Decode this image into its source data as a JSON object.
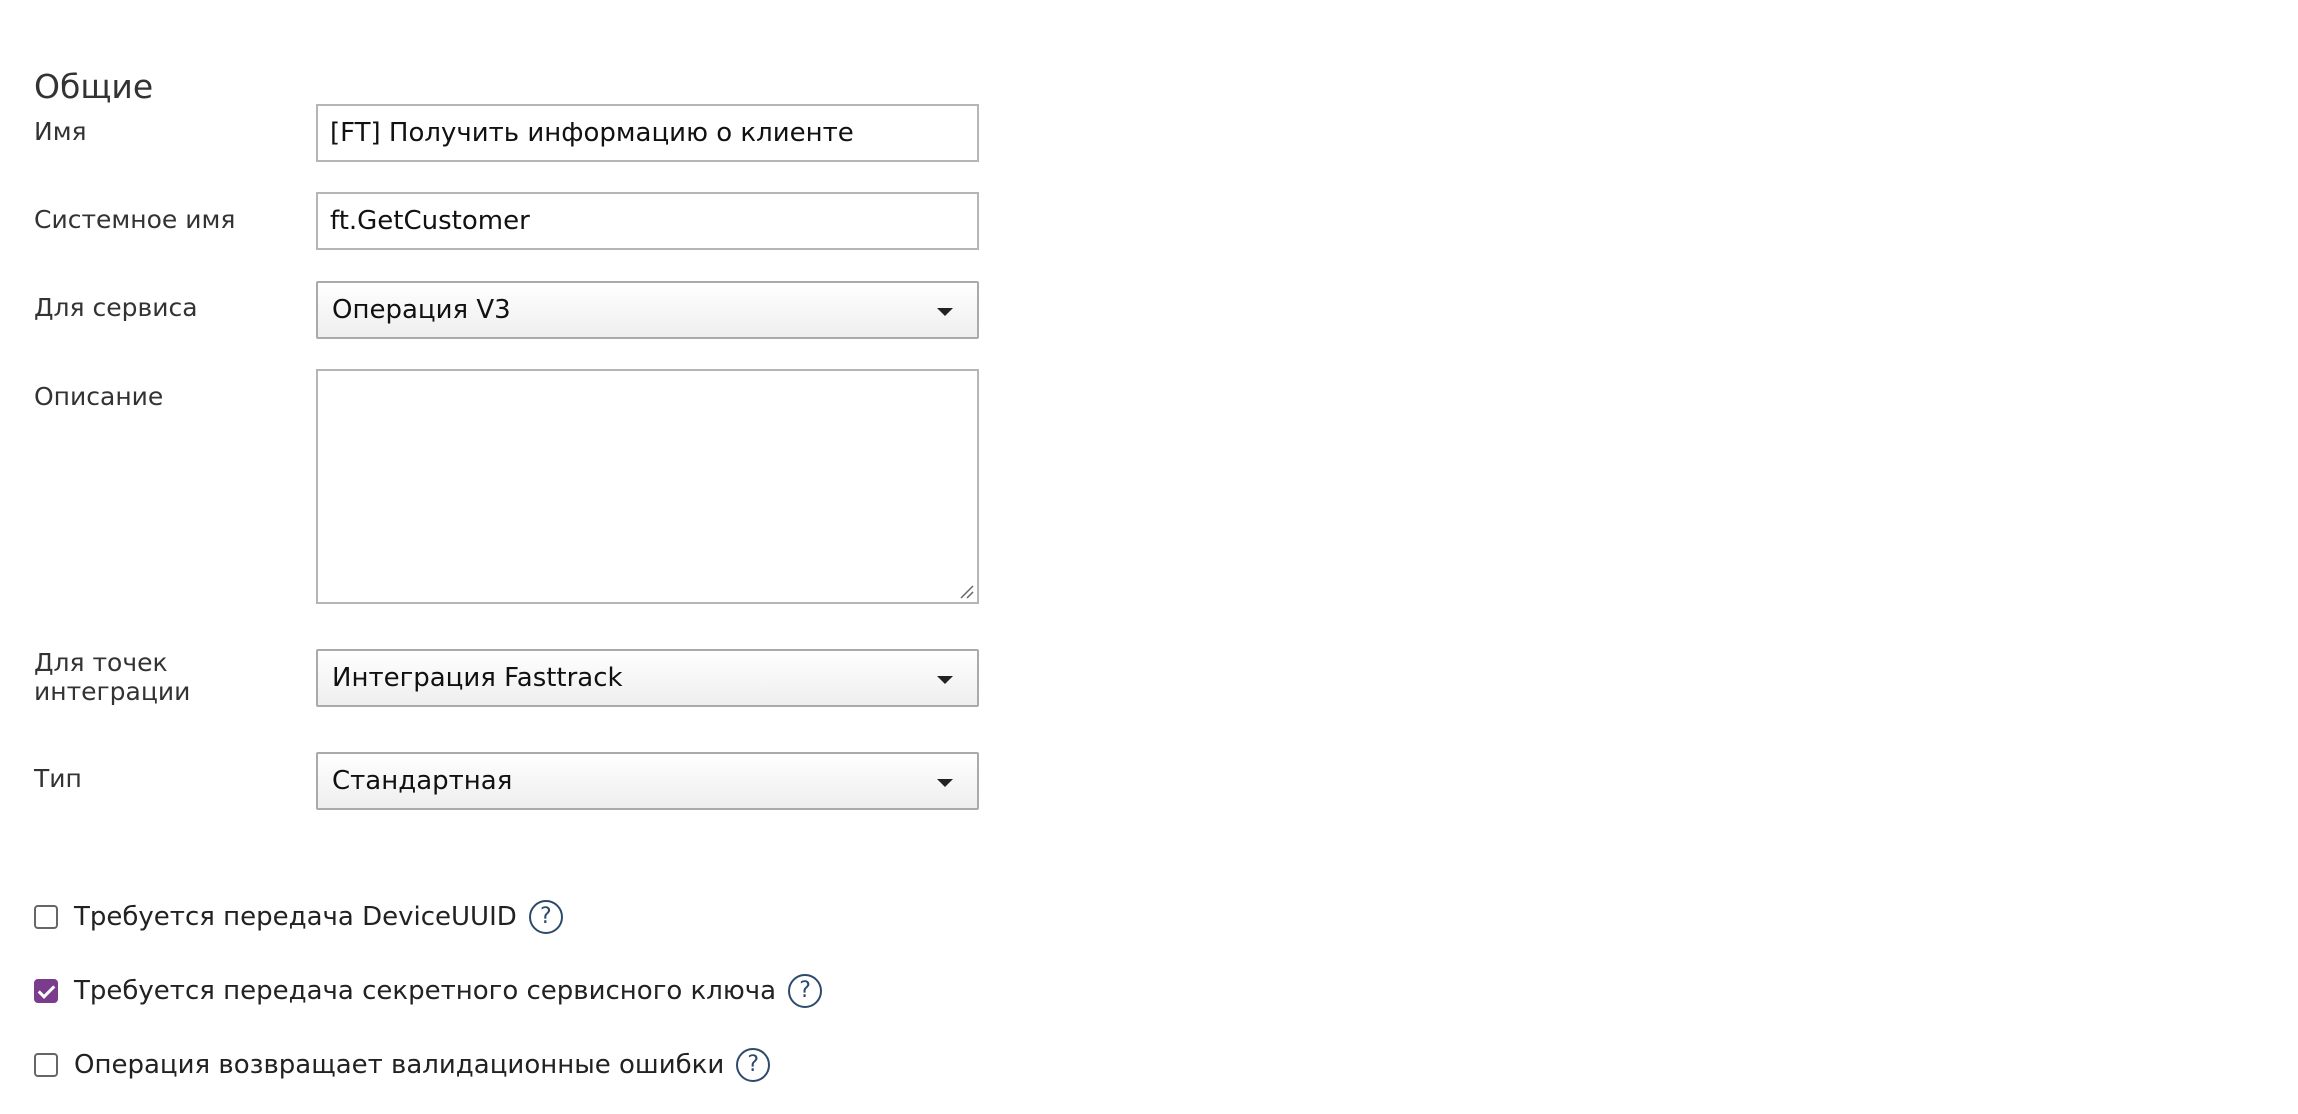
{
  "section": {
    "title": "Общие"
  },
  "fields": {
    "name": {
      "label": "Имя",
      "value": "[FT] Получить информацию о клиенте"
    },
    "system_name": {
      "label": "Системное имя",
      "value": "ft.GetCustomer"
    },
    "service": {
      "label": "Для сервиса",
      "value": "Операция V3"
    },
    "description": {
      "label": "Описание",
      "value": ""
    },
    "integration_points": {
      "label_line1": "Для точек",
      "label_line2": "интеграции",
      "value": "Интеграция Fasttrack"
    },
    "type": {
      "label": "Тип",
      "value": "Стандартная"
    }
  },
  "options": [
    {
      "label": "Требуется передача DeviceUUID",
      "checked": false,
      "help": "?"
    },
    {
      "label": "Требуется передача секретного сервисного ключа",
      "checked": true,
      "help": "?"
    },
    {
      "label": "Операция возвращает валидационные ошибки",
      "checked": false,
      "help": "?"
    }
  ],
  "colors": {
    "accent": "#7b3c8d",
    "help_icon": "#2e4a6b",
    "field_border": "#b5b5b5"
  },
  "icons": {
    "select_caret": "caret-down-icon",
    "help": "question-circle-icon",
    "resize": "resize-grip-icon"
  }
}
